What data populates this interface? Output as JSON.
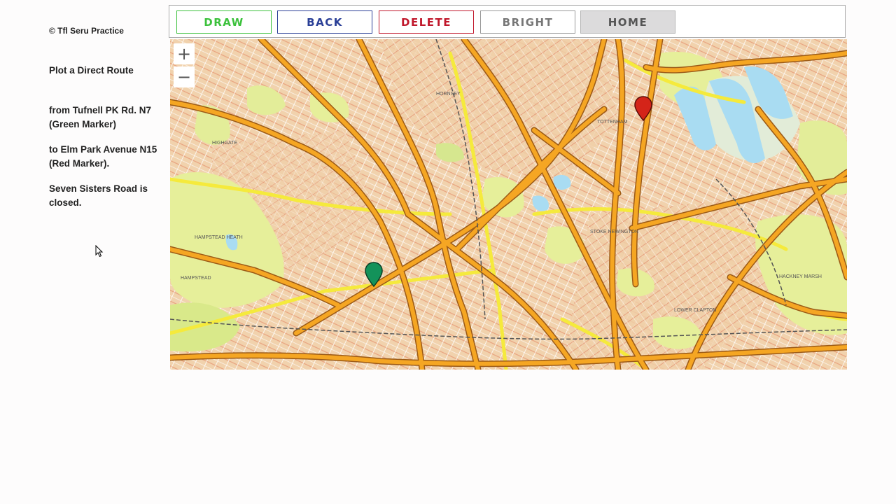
{
  "sidebar": {
    "copyright": "© Tfl Seru Practice",
    "task": "Plot a Direct Route",
    "from_line1": "from Tufnell PK Rd. N7",
    "from_line2": "(Green Marker)",
    "to_line1": "to Elm Park Avenue N15",
    "to_line2": "(Red Marker).",
    "closure_line1": "Seven Sisters Road is",
    "closure_line2": "closed."
  },
  "toolbar": {
    "draw": "DRAW",
    "back": "BACK",
    "delete": "DELETE",
    "bright": "BRIGHT",
    "home": "HOME"
  },
  "colors": {
    "draw": "#3cc13c",
    "back": "#2a3f97",
    "delete": "#c0172b",
    "bright": "#777777",
    "home": "#555555",
    "home_bg": "#dcdbdc",
    "start_marker": "#13925a",
    "end_marker": "#d42419"
  },
  "map": {
    "zoom_in": "+",
    "zoom_out": "−",
    "labels": {
      "hampstead_heath": "HAMPSTEAD HEATH",
      "hampstead": "HAMPSTEAD",
      "highgate": "HIGHGATE",
      "hornsey": "HORNSEY",
      "stoke_newington": "STOKE NEWINGTON",
      "hackney_marsh": "HACKNEY MARSH",
      "lower_clapton": "LOWER CLAPTON",
      "tottenham": "TOTTENHAM"
    },
    "markers": [
      {
        "name": "start-marker",
        "label": "Tufnell PK Rd. N7",
        "color": "green"
      },
      {
        "name": "end-marker",
        "label": "Elm Park Avenue N15",
        "color": "red"
      }
    ]
  }
}
